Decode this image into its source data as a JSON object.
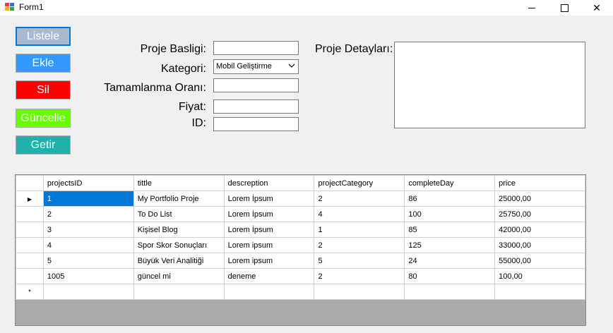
{
  "window": {
    "title": "Form1",
    "min_glyph": "—",
    "close_glyph": "✕"
  },
  "buttons": [
    {
      "label": "Listele",
      "bg": "#aab8d0"
    },
    {
      "label": "Ekle",
      "bg": "#3399ff"
    },
    {
      "label": "Sil",
      "bg": "#ff0000"
    },
    {
      "label": "Güncelle",
      "bg": "#66ff00"
    },
    {
      "label": "Getir",
      "bg": "#20b2aa"
    }
  ],
  "form": {
    "title_label": "Proje Basligi:",
    "category_label": "Kategori:",
    "completion_label": "Tamamlanma Oranı:",
    "price_label": "Fiyat:",
    "id_label": "ID:",
    "details_label": "Proje Detayları:",
    "title_value": "",
    "category_value": "Mobil Geliştirme",
    "completion_value": "",
    "price_value": "",
    "id_value": "",
    "details_value": ""
  },
  "grid": {
    "columns": [
      "projectsID",
      "tittle",
      "descreption",
      "projectCategory",
      "completeDay",
      "price"
    ],
    "rows": [
      [
        "1",
        "My Portfolio Proje",
        "Lorem İpsum",
        "2",
        "86",
        "25000,00"
      ],
      [
        "2",
        "To Do List",
        "Lorem İpsum",
        "4",
        "100",
        "25750,00"
      ],
      [
        "3",
        "Kişisel Blog",
        "Lorem İpsum",
        "1",
        "85",
        "42000,00"
      ],
      [
        "4",
        "Spor Skor Sonuçları",
        "Lorem ipsum",
        "2",
        "125",
        "33000,00"
      ],
      [
        "5",
        "Büyük Veri Analitiği",
        "Lorem ipsum",
        "5",
        "24",
        "55000,00"
      ],
      [
        "1005",
        "güncel mi",
        "deneme",
        "2",
        "80",
        "100,00"
      ]
    ],
    "current_row_glyph": "▶",
    "new_row_glyph": "*"
  },
  "colors": {
    "selection": "#0078d7",
    "grid_background": "#ababab"
  }
}
